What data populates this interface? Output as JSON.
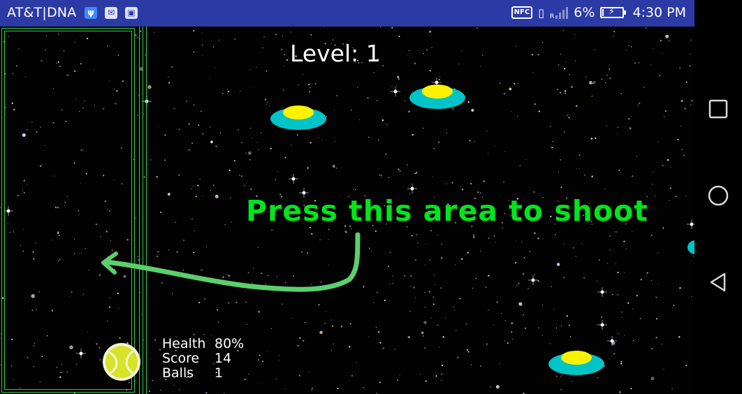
{
  "status_bar": {
    "carrier": "AT&T|DNA",
    "nfc_label": "NFC",
    "roaming_label": "R",
    "battery_percent": "6%",
    "time": "4:30 PM",
    "battery_level": 0.06,
    "icons": [
      "usb-icon",
      "mail-icon",
      "gallery-icon",
      "nfc-icon",
      "vibrate-icon",
      "signal-icon",
      "battery-charging-icon"
    ]
  },
  "game": {
    "level_text": "Level: 1",
    "instruction": "Press this area to shoot",
    "hud": {
      "health_label": "Health",
      "health_value": "80%",
      "score_label": "Score",
      "score_value": "14",
      "balls_label": "Balls",
      "balls_value": "1"
    },
    "colors": {
      "ufo_body": "#00c4c8",
      "ufo_dome": "#fff200",
      "instruction": "#00e51c",
      "arrow": "#5ccf6c",
      "zone_border": "#2bd24a"
    }
  },
  "nav_bar": {
    "buttons": [
      "recents-icon",
      "home-icon",
      "back-icon"
    ]
  }
}
